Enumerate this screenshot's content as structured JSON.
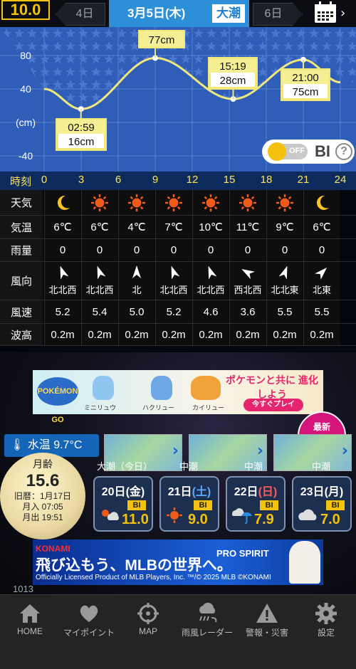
{
  "header": {
    "version": "10.0",
    "prev_day": "4日",
    "current_date": "3月5日(木)",
    "tide_type": "大潮",
    "next_day": "6日"
  },
  "chart": {
    "y_ticks": [
      "80",
      "40",
      "(cm)",
      "-40"
    ],
    "callouts": [
      {
        "time": "02:59",
        "height": "16cm"
      },
      {
        "time": "",
        "height": "77cm"
      },
      {
        "time": "15:19",
        "height": "28cm"
      },
      {
        "time": "21:00",
        "height": "75cm"
      }
    ],
    "bi_toggle": {
      "state": "OFF",
      "label": "BI",
      "help": "?"
    }
  },
  "chart_data": {
    "type": "line",
    "x": [
      0,
      2.983,
      9.0,
      15.317,
      21.0,
      24
    ],
    "y": [
      40,
      16,
      77,
      28,
      75,
      48
    ],
    "ylim": [
      -50,
      110
    ],
    "xlim": [
      0,
      24
    ],
    "xticks": [
      0,
      3,
      6,
      9,
      12,
      15,
      18,
      21,
      24
    ],
    "yticks": [
      80,
      40,
      -40
    ],
    "ylabel": "(cm)",
    "xlabel": "時刻",
    "grid": true,
    "annotations": [
      {
        "x": 2.983,
        "y": 16,
        "text": "02:59 16cm"
      },
      {
        "x": 9.0,
        "y": 77,
        "text": "77cm"
      },
      {
        "x": 15.317,
        "y": 28,
        "text": "15:19 28cm"
      },
      {
        "x": 21.0,
        "y": 75,
        "text": "21:00 75cm"
      }
    ]
  },
  "hours": {
    "label": "時刻",
    "values": [
      "0",
      "3",
      "6",
      "9",
      "12",
      "15",
      "18",
      "21",
      "24"
    ]
  },
  "weather": {
    "rows": [
      "天気",
      "気温",
      "雨量",
      "風向",
      "風速",
      "波高"
    ],
    "icons": [
      "moon-icon",
      "sun-icon",
      "sun-icon",
      "sun-icon",
      "sun-icon",
      "sun-icon",
      "sun-icon",
      "moon-icon"
    ],
    "temps": [
      "6℃",
      "6℃",
      "4℃",
      "7℃",
      "10℃",
      "11℃",
      "9℃",
      "6℃"
    ],
    "rain": [
      "0",
      "0",
      "0",
      "0",
      "0",
      "0",
      "0",
      "0"
    ],
    "wind_dirs": [
      "北北西",
      "北北西",
      "北",
      "北北西",
      "北北西",
      "西北西",
      "北北東",
      "北東"
    ],
    "wind_angles": [
      -20,
      -20,
      0,
      -20,
      -20,
      -60,
      20,
      45
    ],
    "wind_speeds": [
      "5.2",
      "5.4",
      "5.0",
      "5.2",
      "4.6",
      "3.6",
      "5.5",
      "5.5"
    ],
    "waves": [
      "0.2m",
      "0.2m",
      "0.2m",
      "0.2m",
      "0.2m",
      "0.2m",
      "0.2m",
      "0.2m"
    ]
  },
  "ad1": {
    "logo": "POKÉMON GO",
    "title": "ポケモンと共に 進化しよう",
    "captions": [
      "ミニリュウ",
      "ハクリュー",
      "カイリュー"
    ],
    "button": "今すぐプレイ"
  },
  "fish_badge": {
    "line1": "最新",
    "line2": "釣果"
  },
  "water_temp": "水温 9.7°C",
  "tide_tiles": [
    "大潮（今日）",
    "中潮",
    "中潮",
    "中潮"
  ],
  "moon": {
    "label": "月齢",
    "age": "15.6",
    "lunar": "旧暦：1月17日",
    "rise": "月入 07:05",
    "set": "月出 19:51"
  },
  "forecast": [
    {
      "day": "20日",
      "dow": "(金)",
      "dow_kind": "wd",
      "weather": "sun-cloud-icon",
      "bi_label": "BI",
      "bi": "11.0"
    },
    {
      "day": "21日",
      "dow": "(土)",
      "dow_kind": "sat",
      "weather": "sun-icon",
      "bi_label": "BI",
      "bi": "9.0"
    },
    {
      "day": "22日",
      "dow": "(日)",
      "dow_kind": "sun",
      "weather": "cloud-umbrella-icon",
      "bi_label": "BI",
      "bi": "7.9"
    },
    {
      "day": "23日",
      "dow": "(月)",
      "dow_kind": "wd",
      "weather": "cloud-icon",
      "bi_label": "BI",
      "bi": "7.0"
    }
  ],
  "ad2": {
    "brand": "KONAMI",
    "headline": "飛び込もう、MLBの世界へ。",
    "product": "PRO SPIRIT",
    "fine": "Officially Licensed Product of MLB Players, Inc. ™/© 2025 MLB ©KONAMI"
  },
  "pressure_label": "1013",
  "nav": [
    {
      "label": "HOME",
      "icon": "home-icon"
    },
    {
      "label": "マイポイント",
      "icon": "heart-icon"
    },
    {
      "label": "MAP",
      "icon": "crosshair-icon"
    },
    {
      "label": "雨風レーダー",
      "icon": "rain-wind-icon"
    },
    {
      "label": "警報・災害",
      "icon": "warning-icon"
    },
    {
      "label": "設定",
      "icon": "gear-icon"
    }
  ],
  "colors": {
    "accent": "#2c8fd7",
    "tide_line": "#f0e87a",
    "hour_text": "#ffe35a",
    "bi_yellow": "#f4c20d",
    "fish_pink": "#d4147a"
  }
}
